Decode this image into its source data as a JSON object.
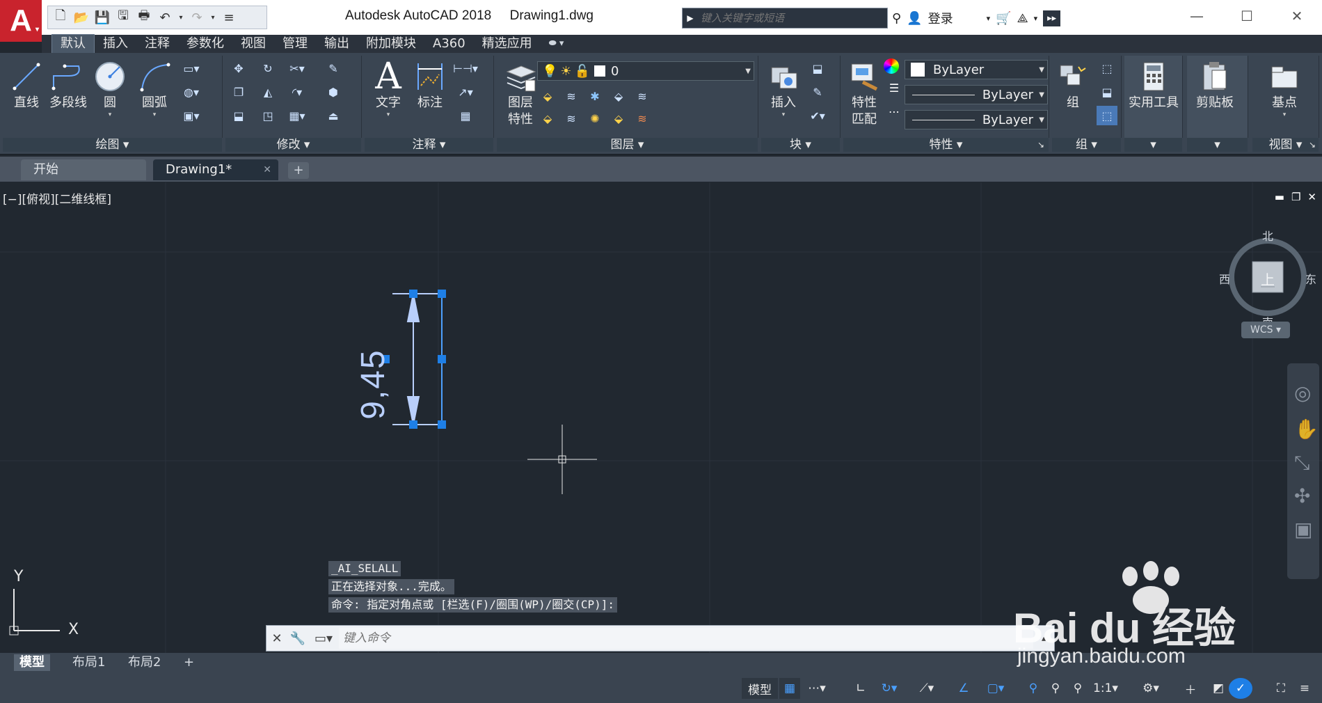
{
  "title_bar": {
    "app_name": "Autodesk AutoCAD 2018",
    "file_name": "Drawing1.dwg",
    "search_placeholder": "键入关键字或短语",
    "login_label": "登录"
  },
  "ribbon_tabs": [
    "默认",
    "插入",
    "注释",
    "参数化",
    "视图",
    "管理",
    "输出",
    "附加模块",
    "A360",
    "精选应用"
  ],
  "ribbon": {
    "draw": {
      "title": "绘图",
      "line": "直线",
      "polyline": "多段线",
      "circle": "圆",
      "arc": "圆弧"
    },
    "modify": {
      "title": "修改"
    },
    "annotation": {
      "title": "注释",
      "text": "文字",
      "dimension": "标注"
    },
    "layers": {
      "title": "图层",
      "layer_props_line1": "图层",
      "layer_props_line2": "特性",
      "current_layer": "0"
    },
    "block": {
      "title": "块",
      "insert": "插入"
    },
    "properties": {
      "title": "特性",
      "match_line1": "特性",
      "match_line2": "匹配",
      "color": "ByLayer",
      "linetype": "ByLayer",
      "lineweight": "ByLayer"
    },
    "groups": {
      "title": "组",
      "group": "组"
    },
    "utilities": {
      "label": "实用工具"
    },
    "clipboard": {
      "label": "剪贴板"
    },
    "view": {
      "title": "视图",
      "base": "基点"
    }
  },
  "file_tabs": {
    "start": "开始",
    "drawing": "Drawing1*"
  },
  "viewport": {
    "label": "[−][俯视][二维线框]",
    "dimension_text": "9,45",
    "compass": {
      "north": "北",
      "south": "南",
      "east": "东",
      "west": "西",
      "top": "上"
    },
    "wcs": "WCS",
    "ucs_x": "X",
    "ucs_y": "Y"
  },
  "command": {
    "history": [
      "_AI_SELALL",
      "正在选择对象...完成。",
      "命令: 指定对角点或 [栏选(F)/圈围(WP)/圈交(CP)]:"
    ],
    "placeholder": "键入命令"
  },
  "layout_tabs": [
    "模型",
    "布局1",
    "布局2"
  ],
  "status_bar": {
    "model": "模型",
    "scale": "1:1"
  },
  "watermark": {
    "brand": "Bai du 经验",
    "url": "jingyan.baidu.com"
  },
  "colors": {
    "selection_blue": "#1e7fe6",
    "dimension_color": "#b9cffb",
    "canvas": "#212830",
    "ribbon": "#3a4552",
    "accent_red": "#c9232d"
  }
}
